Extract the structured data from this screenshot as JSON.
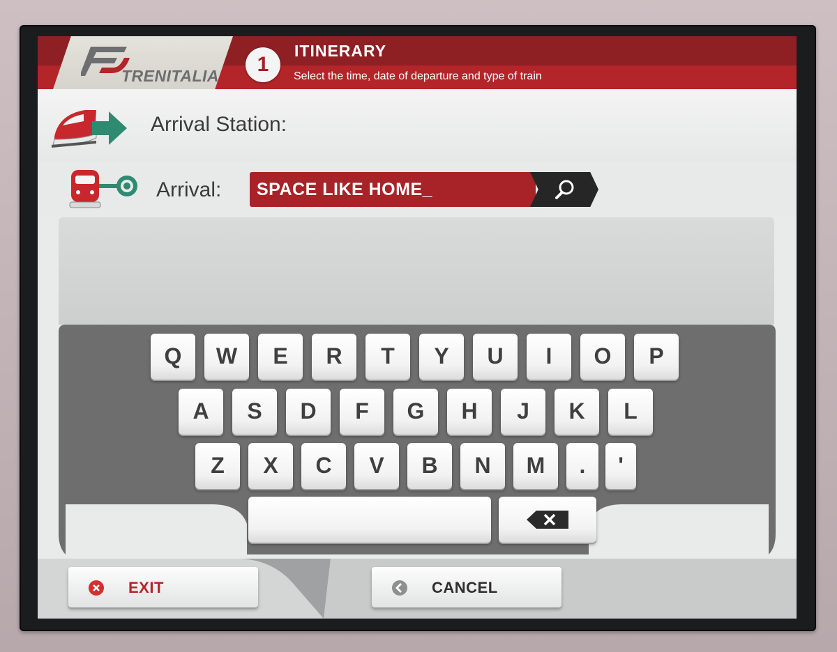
{
  "header": {
    "brand": "TRENITALIA",
    "step_number": "1",
    "step_title": "ITINERARY",
    "step_subtitle": "Select the time, date of departure and type of train"
  },
  "station_row": {
    "label": "Arrival Station:",
    "icon": "train-arrow-icon"
  },
  "arrival_row": {
    "label": "Arrival:",
    "icon": "train-destination-icon",
    "input_value": "SPACE LIKE HOME_",
    "search_icon": "search-icon"
  },
  "keyboard": {
    "row1": [
      "Q",
      "W",
      "E",
      "R",
      "T",
      "Y",
      "U",
      "I",
      "O",
      "P"
    ],
    "row2": [
      "A",
      "S",
      "D",
      "F",
      "G",
      "H",
      "J",
      "K",
      "L"
    ],
    "row3": [
      "Z",
      "X",
      "C",
      "V",
      "B",
      "N",
      "M",
      ".",
      "'"
    ],
    "space_icon": "space-key",
    "backspace_icon": "backspace-icon"
  },
  "footer": {
    "exit_label": "EXIT",
    "cancel_label": "CANCEL"
  },
  "colors": {
    "brand_red": "#b4252a",
    "brand_dark_red": "#8e1f23",
    "keyboard_bg": "#6e6e6e",
    "search_button": "#262626"
  }
}
